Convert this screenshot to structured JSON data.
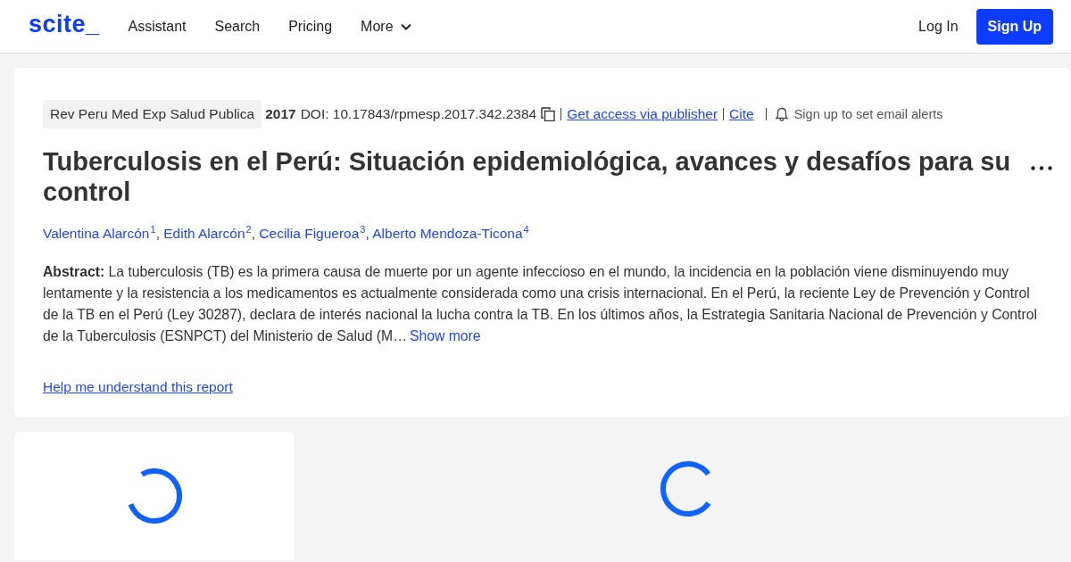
{
  "header": {
    "logo": "scite_",
    "nav": [
      {
        "label": "Assistant",
        "kind": "link"
      },
      {
        "label": "Search",
        "kind": "link"
      },
      {
        "label": "Pricing",
        "kind": "link"
      },
      {
        "label": "More",
        "kind": "dropdown"
      }
    ],
    "login": "Log In",
    "signup": "Sign Up"
  },
  "report": {
    "journal": "Rev Peru Med Exp Salud Publica",
    "year": "2017",
    "doi": "DOI: 10.17843/rpmesp.2017.342.2384",
    "access_link": "Get access via publisher",
    "cite_link": "Cite",
    "alerts": "Sign up to set email alerts",
    "title": "Tuberculosis en el Perú: Situación epidemiológica, avances y desafíos para su control",
    "authors": [
      {
        "name": "Valentina Alarcón",
        "affiliation": "1",
        "separator": ","
      },
      {
        "name": "Edith Alarcón",
        "affiliation": "2",
        "separator": ","
      },
      {
        "name": "Cecilia Figueroa",
        "affiliation": "3",
        "separator": ","
      },
      {
        "name": "Alberto Mendoza-Ticona",
        "affiliation": "4"
      }
    ],
    "abstract": "**Abstract:** La tuberculosis (TB) es la primera causa de muerte por un agente infeccioso en el mundo, la incidencia en la población viene disminuyendo muy lentamente y la resistencia a los medicamentos es actualmente considerada como una crisis internacional. En el Perú, la reciente Ley de Prevención y Control de la TB en el Perú (Ley 30287), declara de interés nacional la lucha contra la TB. En los últimos años, la Estrategia Sanitaria Nacional de Prevención y Control de la Tuberculosis (ESNPCT) del Ministerio de Salud (M…",
    "show_more": "Show more",
    "help_link": "Help me understand this report"
  }
}
